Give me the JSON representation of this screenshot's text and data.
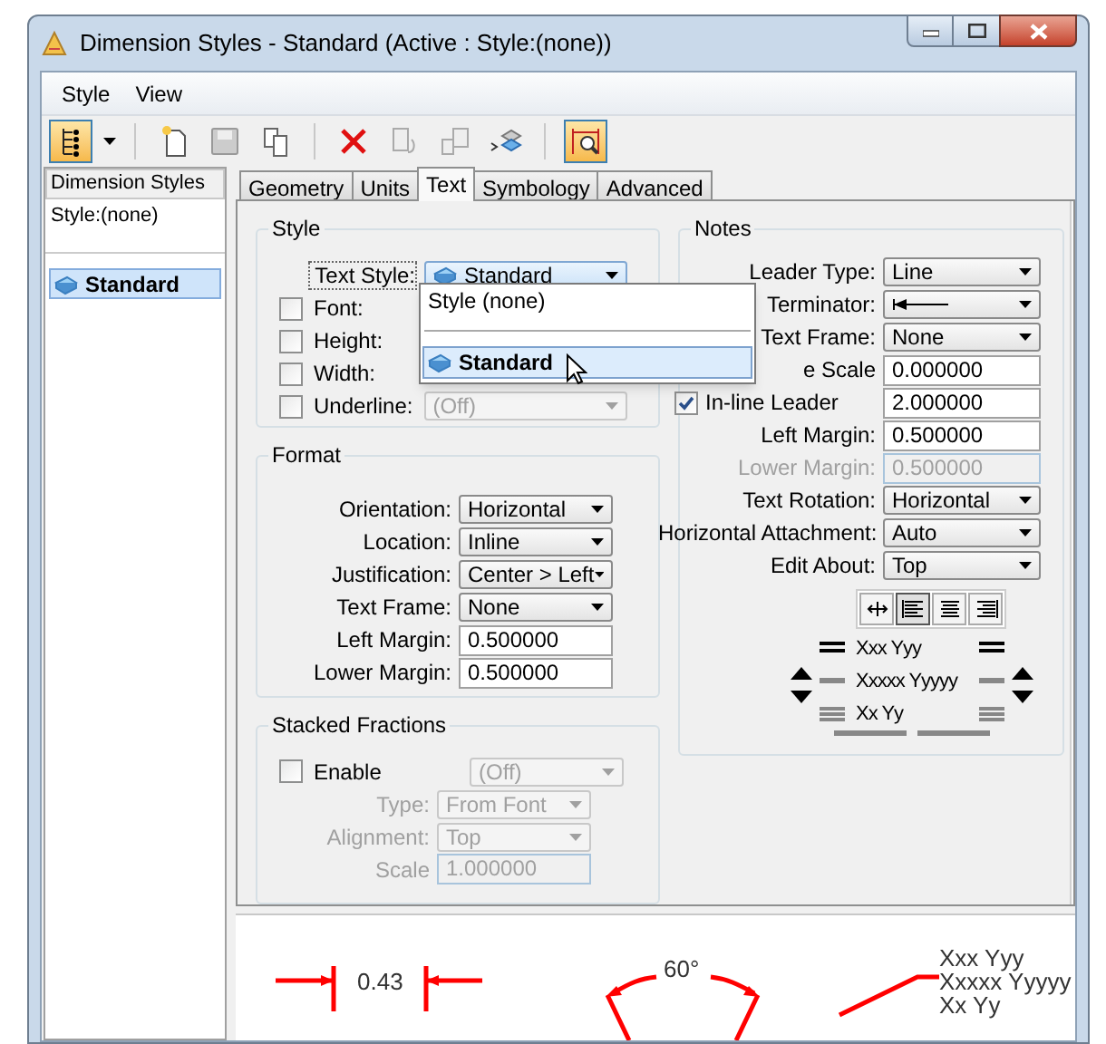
{
  "window": {
    "title": "Dimension Styles -  Standard (Active : Style:(none))"
  },
  "menu": [
    {
      "label": "Style"
    },
    {
      "label": "View"
    }
  ],
  "sidebar": {
    "header": "Dimension Styles",
    "filter": "Style:(none)",
    "items": [
      {
        "label": "Standard",
        "selected": true
      }
    ]
  },
  "tabs": [
    {
      "label": "Geometry",
      "selected": false
    },
    {
      "label": "Units",
      "selected": false
    },
    {
      "label": "Text",
      "selected": true
    },
    {
      "label": "Symbology",
      "selected": false
    },
    {
      "label": "Advanced",
      "selected": false
    }
  ],
  "style_group": {
    "title": "Style",
    "text_style": {
      "label": "Text Style:",
      "value": "Standard"
    },
    "rows": [
      {
        "label": "Font:",
        "checked": false
      },
      {
        "label": "Height:",
        "checked": false
      },
      {
        "label": "Width:",
        "checked": false
      },
      {
        "label": "Underline:",
        "checked": false,
        "value": "(Off)",
        "disabled": true
      }
    ],
    "dropdown": [
      {
        "label": "Style (none)",
        "selected": false
      },
      {
        "label": "Standard",
        "selected": true
      }
    ]
  },
  "format_group": {
    "title": "Format",
    "rows": [
      {
        "label": "Orientation:",
        "kind": "select",
        "value": "Horizontal"
      },
      {
        "label": "Location:",
        "kind": "select",
        "value": "Inline"
      },
      {
        "label": "Justification:",
        "kind": "select",
        "value": "Center > Left"
      },
      {
        "label": "Text Frame:",
        "kind": "select",
        "value": "None"
      },
      {
        "label": "Left Margin:",
        "kind": "input",
        "value": "0.500000"
      },
      {
        "label": "Lower Margin:",
        "kind": "input",
        "value": "0.500000"
      }
    ]
  },
  "stacked_group": {
    "title": "Stacked Fractions",
    "enable": {
      "label": "Enable",
      "checked": false,
      "value": "(Off)"
    },
    "rows": [
      {
        "label": "Type:",
        "kind": "select",
        "value": "From Font",
        "disabled": true
      },
      {
        "label": "Alignment:",
        "kind": "select",
        "value": "Top",
        "disabled": true
      },
      {
        "label": "Scale",
        "kind": "input",
        "value": "1.000000",
        "disabled": true
      }
    ]
  },
  "notes_group": {
    "title": "Notes",
    "rows": [
      {
        "label": "Leader Type:",
        "kind": "select",
        "value": "Line"
      },
      {
        "label": "Terminator:",
        "kind": "terminator"
      },
      {
        "label": "Text Frame:",
        "kind": "select",
        "value": "None"
      },
      {
        "label": "e Scale",
        "kind": "input",
        "value": "0.000000"
      },
      {
        "label": "In-line Leader",
        "kind": "check",
        "checked": true,
        "value": "2.000000"
      },
      {
        "label": "Left Margin:",
        "kind": "input",
        "value": "0.500000"
      },
      {
        "label": "Lower Margin:",
        "kind": "input",
        "value": "0.500000",
        "disabled": true
      },
      {
        "label": "Text Rotation:",
        "kind": "select",
        "value": "Horizontal"
      },
      {
        "label": "Horizontal Attachment:",
        "kind": "select",
        "value": "Auto"
      },
      {
        "label": "Edit About:",
        "kind": "select",
        "value": "Top"
      }
    ],
    "justify_buttons": [
      {
        "kind": "hold",
        "selected": false
      },
      {
        "kind": "left",
        "selected": true
      },
      {
        "kind": "center",
        "selected": false
      },
      {
        "kind": "right",
        "selected": false
      }
    ],
    "sample_lines": [
      "Xxx Yyy",
      "Xxxxx Yyyyy",
      "Xx Yy"
    ]
  },
  "preview": {
    "linear": "0.43",
    "angular": "60°",
    "note_lines": [
      "Xxx Yyy",
      "Xxxxx Yyyyy",
      "Xx Yy"
    ]
  }
}
